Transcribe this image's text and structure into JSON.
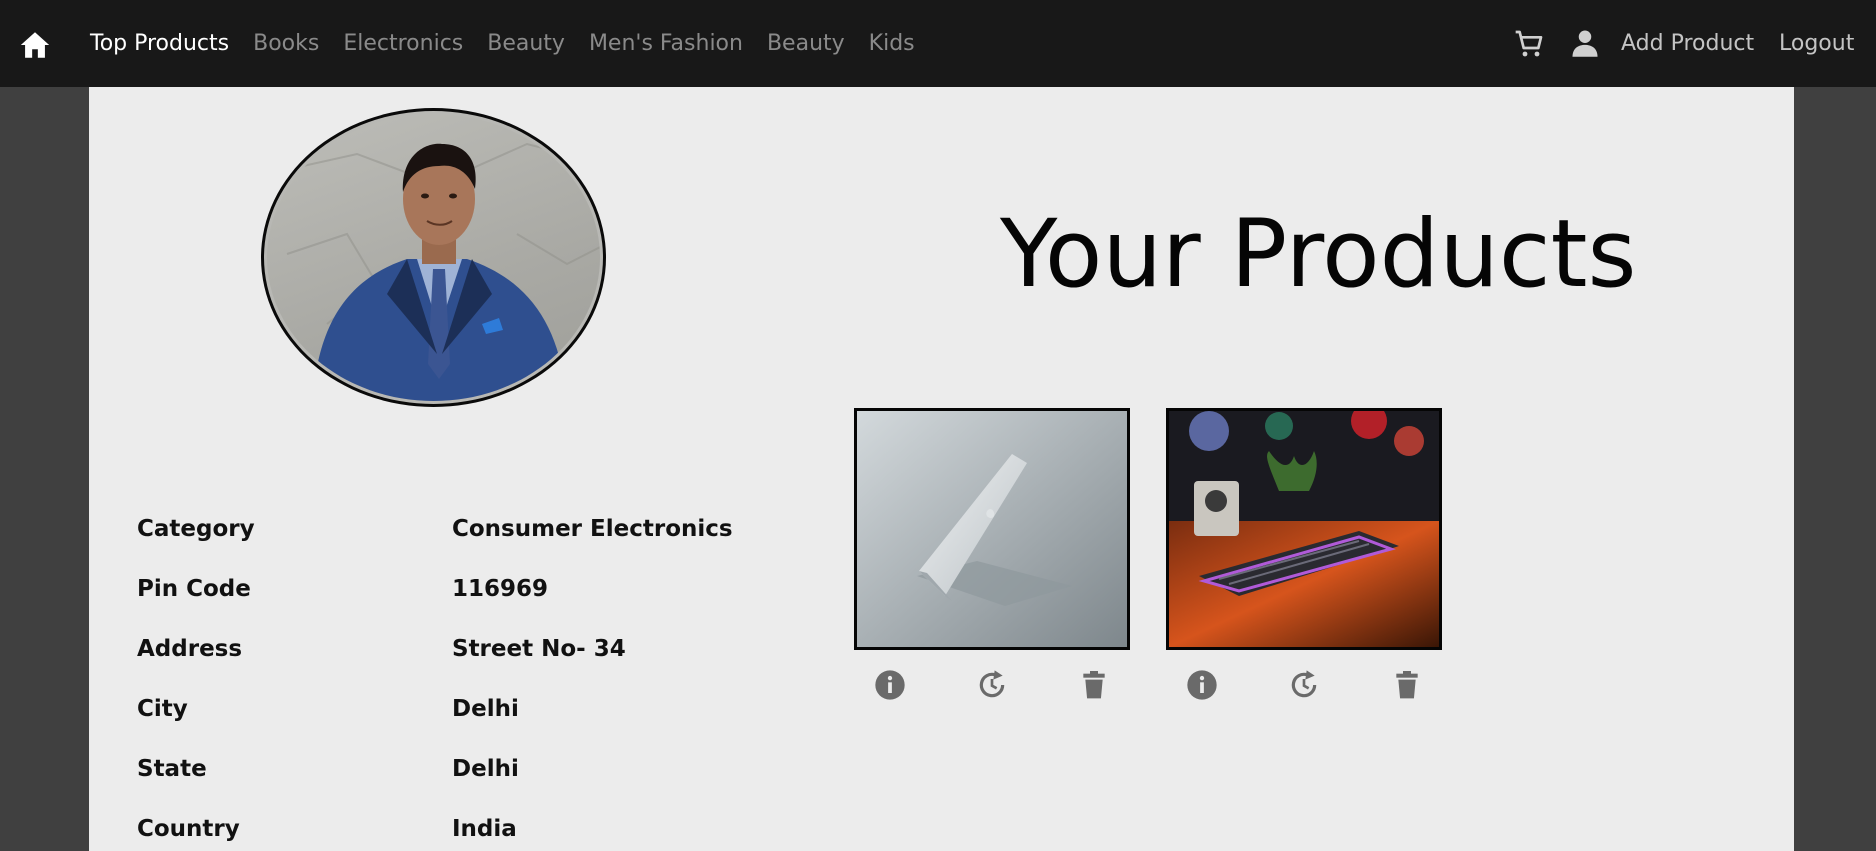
{
  "nav": {
    "links": [
      "Top Products",
      "Books",
      "Electronics",
      "Beauty",
      "Men's Fashion",
      "Beauty",
      "Kids"
    ],
    "add_product": "Add Product",
    "logout": "Logout",
    "icons": [
      "home-icon",
      "cart-icon",
      "user-icon"
    ]
  },
  "page": {
    "title": "Your Products"
  },
  "details": [
    {
      "label": "Category",
      "value": "Consumer Electronics"
    },
    {
      "label": "Pin Code",
      "value": "116969"
    },
    {
      "label": "Address",
      "value": "Street No- 34"
    },
    {
      "label": "City",
      "value": "Delhi"
    },
    {
      "label": "State",
      "value": "Delhi"
    },
    {
      "label": "Country",
      "value": "India"
    }
  ],
  "products": [
    {
      "image": "laptop",
      "actions": [
        "info-icon",
        "update-icon",
        "delete-icon"
      ]
    },
    {
      "image": "keyboard",
      "actions": [
        "info-icon",
        "update-icon",
        "delete-icon"
      ]
    }
  ],
  "colors": {
    "navbar": "#181818",
    "active_link": "#ffffff",
    "inactive_link": "#8a8a8a",
    "panel": "#ececec",
    "background": "#404040",
    "icon": "#6a6a6a"
  }
}
